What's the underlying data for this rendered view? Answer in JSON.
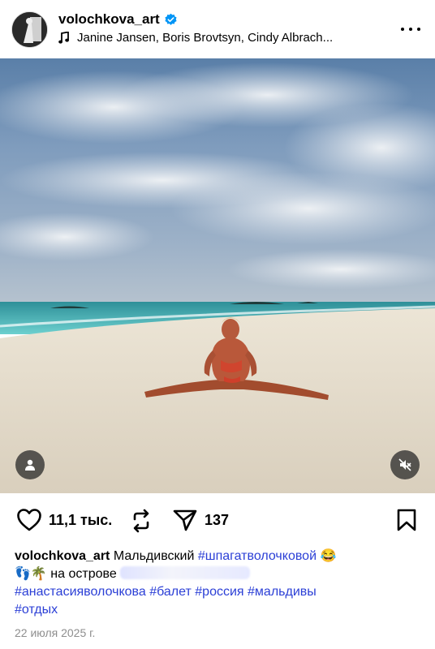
{
  "header": {
    "username": "volochkova_art",
    "music": "Janine Jansen, Boris Brovtsyn, Cindy Albrach..."
  },
  "icons": {
    "verified": "verified-badge-icon",
    "music": "music-note-icon",
    "more": "more-dots-icon",
    "tag": "person-tag-icon",
    "mute": "speaker-muted-icon",
    "like": "heart-icon",
    "repost": "repost-icon",
    "share": "paper-plane-icon",
    "save": "bookmark-icon"
  },
  "colors": {
    "hashtag": "#2b3fd6",
    "verified": "#0095f6"
  },
  "actions": {
    "likes": "11,1 тыс.",
    "shares": "137"
  },
  "caption": {
    "username": "volochkova_art",
    "text_1": "Мальдивский",
    "hashtag_1": "#шпагатволочковой",
    "emoji_1": "😂",
    "emoji_2": "👣🌴",
    "text_2": "на острове",
    "hashtag_2": "#анастасияволочкова",
    "hashtag_3": "#балет",
    "hashtag_4": "#россия",
    "hashtag_5": "#мальдивы",
    "hashtag_6": "#отдых"
  },
  "date": "22 июля 2025 г."
}
